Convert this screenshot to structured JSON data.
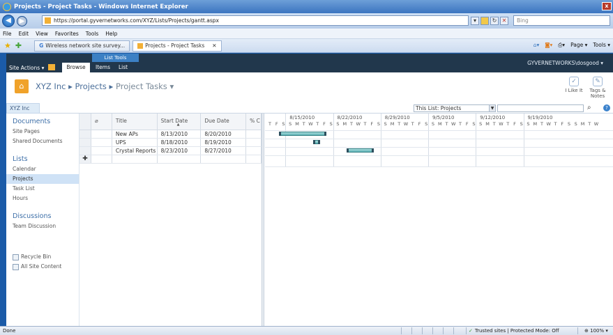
{
  "window": {
    "title": "Projects - Project Tasks - Windows Internet Explorer"
  },
  "browser": {
    "url": "https://portal.gyvernetworks.com/XYZ/Lists/Projects/gantt.aspx",
    "search_value": "Bing",
    "menu": [
      "File",
      "Edit",
      "View",
      "Favorites",
      "Tools",
      "Help"
    ],
    "tabs": [
      {
        "label": "Wireless network site survey..."
      },
      {
        "label": "Projects - Project Tasks"
      }
    ],
    "commands": [
      "Page ▾",
      "Tools ▾"
    ]
  },
  "ribbon": {
    "site_actions": "Site Actions ▾",
    "list_tools": "List Tools",
    "tabs": [
      "Browse",
      "Items",
      "List"
    ],
    "user": "GYVERNETWORKS\\dosgood ▾"
  },
  "header": {
    "crumb_root": "XYZ Inc",
    "crumb_mid": "Projects",
    "crumb_cur": "Project Tasks",
    "like_it": "I Like It",
    "tags_notes_1": "Tags &",
    "tags_notes_2": "Notes"
  },
  "toprow": {
    "site_tab": "XYZ Inc",
    "scope": "This List: Projects"
  },
  "nav": {
    "documents": "Documents",
    "site_pages": "Site Pages",
    "shared_documents": "Shared Documents",
    "lists": "Lists",
    "calendar": "Calendar",
    "projects": "Projects",
    "task_list": "Task List",
    "hours": "Hours",
    "discussions": "Discussions",
    "team_discussion": "Team Discussion",
    "recycle_bin": "Recycle Bin",
    "all_site_content": "All Site Content"
  },
  "grid": {
    "columns": {
      "title": "Title",
      "start": "Start Date",
      "due": "Due Date",
      "pct": "% C"
    },
    "rows": [
      {
        "title": "New APs",
        "start": "8/13/2010",
        "due": "8/20/2010"
      },
      {
        "title": "UPS",
        "start": "8/18/2010",
        "due": "8/19/2010"
      },
      {
        "title": "Crystal Reports",
        "start": "8/23/2010",
        "due": "8/27/2010"
      }
    ]
  },
  "gantt": {
    "weeks": [
      "8/15/2010",
      "8/22/2010",
      "8/29/2010",
      "9/5/2010",
      "9/12/2010",
      "9/19/2010"
    ],
    "day_letters": "TFSSMTWTFSSMTWTFSSMTWTFSSMTWTFSSMTWTFSSMTWTFSSMTW",
    "first_day": "8/12/2010"
  },
  "status": {
    "left": "Done",
    "trusted": "Trusted sites | Protected Mode: Off",
    "zoom": "100%"
  }
}
